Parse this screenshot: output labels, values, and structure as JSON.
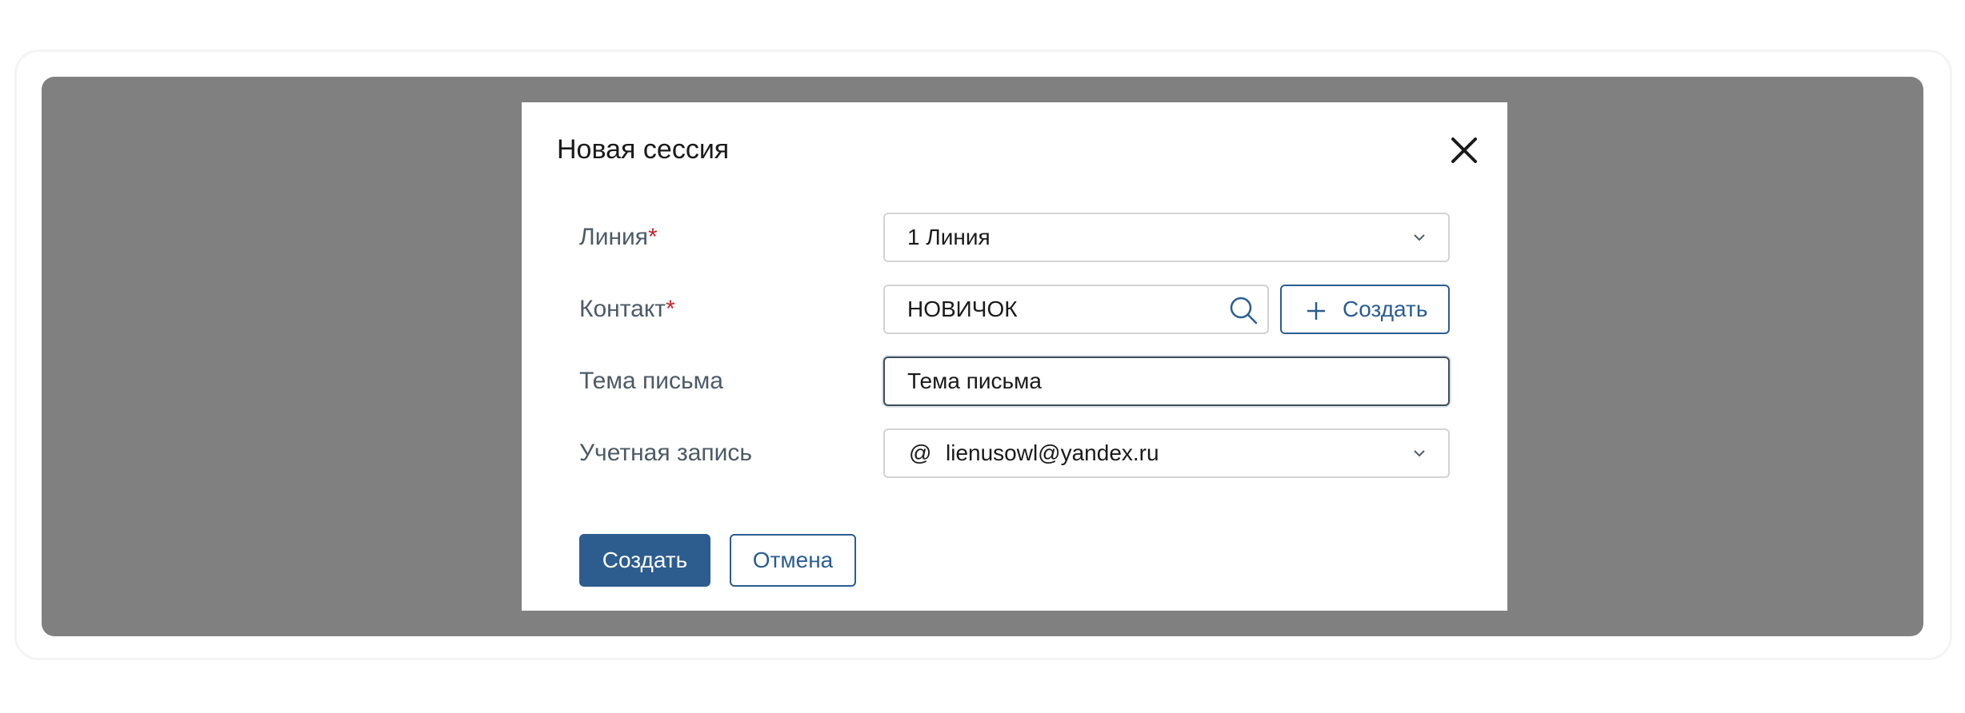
{
  "modal": {
    "title": "Новая сессия",
    "fields": {
      "line": {
        "label": "Линия",
        "required_mark": "*",
        "value": "1 Линия"
      },
      "contact": {
        "label": "Контакт",
        "required_mark": "*",
        "value": "НОВИЧОК",
        "create_button_label": "Создать"
      },
      "subject": {
        "label": "Тема письма",
        "value": "Тема письма"
      },
      "account": {
        "label": "Учетная запись",
        "prefix_symbol": "@",
        "value": "lienusowl@yandex.ru"
      }
    },
    "footer": {
      "submit_label": "Создать",
      "cancel_label": "Отмена"
    }
  },
  "colors": {
    "overlay": "#808080",
    "primary": "#2d5d8f",
    "outline": "#2b5d91",
    "required": "#c0272d",
    "label": "#4d5a66"
  },
  "icons": [
    "close-icon",
    "chevron-down-icon",
    "search-icon",
    "plus-icon",
    "at-sign-icon"
  ]
}
